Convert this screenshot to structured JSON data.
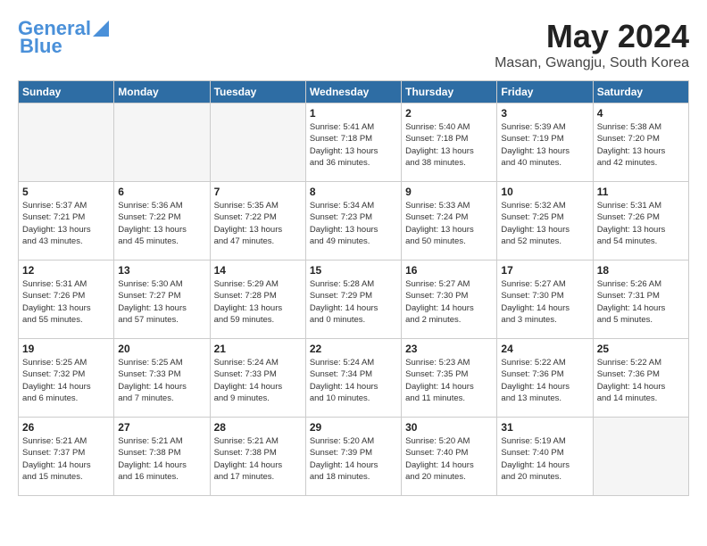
{
  "header": {
    "logo_line1": "General",
    "logo_line2": "Blue",
    "month": "May 2024",
    "location": "Masan, Gwangju, South Korea"
  },
  "days_of_week": [
    "Sunday",
    "Monday",
    "Tuesday",
    "Wednesday",
    "Thursday",
    "Friday",
    "Saturday"
  ],
  "weeks": [
    [
      {
        "day": "",
        "info": ""
      },
      {
        "day": "",
        "info": ""
      },
      {
        "day": "",
        "info": ""
      },
      {
        "day": "1",
        "info": "Sunrise: 5:41 AM\nSunset: 7:18 PM\nDaylight: 13 hours\nand 36 minutes."
      },
      {
        "day": "2",
        "info": "Sunrise: 5:40 AM\nSunset: 7:18 PM\nDaylight: 13 hours\nand 38 minutes."
      },
      {
        "day": "3",
        "info": "Sunrise: 5:39 AM\nSunset: 7:19 PM\nDaylight: 13 hours\nand 40 minutes."
      },
      {
        "day": "4",
        "info": "Sunrise: 5:38 AM\nSunset: 7:20 PM\nDaylight: 13 hours\nand 42 minutes."
      }
    ],
    [
      {
        "day": "5",
        "info": "Sunrise: 5:37 AM\nSunset: 7:21 PM\nDaylight: 13 hours\nand 43 minutes."
      },
      {
        "day": "6",
        "info": "Sunrise: 5:36 AM\nSunset: 7:22 PM\nDaylight: 13 hours\nand 45 minutes."
      },
      {
        "day": "7",
        "info": "Sunrise: 5:35 AM\nSunset: 7:22 PM\nDaylight: 13 hours\nand 47 minutes."
      },
      {
        "day": "8",
        "info": "Sunrise: 5:34 AM\nSunset: 7:23 PM\nDaylight: 13 hours\nand 49 minutes."
      },
      {
        "day": "9",
        "info": "Sunrise: 5:33 AM\nSunset: 7:24 PM\nDaylight: 13 hours\nand 50 minutes."
      },
      {
        "day": "10",
        "info": "Sunrise: 5:32 AM\nSunset: 7:25 PM\nDaylight: 13 hours\nand 52 minutes."
      },
      {
        "day": "11",
        "info": "Sunrise: 5:31 AM\nSunset: 7:26 PM\nDaylight: 13 hours\nand 54 minutes."
      }
    ],
    [
      {
        "day": "12",
        "info": "Sunrise: 5:31 AM\nSunset: 7:26 PM\nDaylight: 13 hours\nand 55 minutes."
      },
      {
        "day": "13",
        "info": "Sunrise: 5:30 AM\nSunset: 7:27 PM\nDaylight: 13 hours\nand 57 minutes."
      },
      {
        "day": "14",
        "info": "Sunrise: 5:29 AM\nSunset: 7:28 PM\nDaylight: 13 hours\nand 59 minutes."
      },
      {
        "day": "15",
        "info": "Sunrise: 5:28 AM\nSunset: 7:29 PM\nDaylight: 14 hours\nand 0 minutes."
      },
      {
        "day": "16",
        "info": "Sunrise: 5:27 AM\nSunset: 7:30 PM\nDaylight: 14 hours\nand 2 minutes."
      },
      {
        "day": "17",
        "info": "Sunrise: 5:27 AM\nSunset: 7:30 PM\nDaylight: 14 hours\nand 3 minutes."
      },
      {
        "day": "18",
        "info": "Sunrise: 5:26 AM\nSunset: 7:31 PM\nDaylight: 14 hours\nand 5 minutes."
      }
    ],
    [
      {
        "day": "19",
        "info": "Sunrise: 5:25 AM\nSunset: 7:32 PM\nDaylight: 14 hours\nand 6 minutes."
      },
      {
        "day": "20",
        "info": "Sunrise: 5:25 AM\nSunset: 7:33 PM\nDaylight: 14 hours\nand 7 minutes."
      },
      {
        "day": "21",
        "info": "Sunrise: 5:24 AM\nSunset: 7:33 PM\nDaylight: 14 hours\nand 9 minutes."
      },
      {
        "day": "22",
        "info": "Sunrise: 5:24 AM\nSunset: 7:34 PM\nDaylight: 14 hours\nand 10 minutes."
      },
      {
        "day": "23",
        "info": "Sunrise: 5:23 AM\nSunset: 7:35 PM\nDaylight: 14 hours\nand 11 minutes."
      },
      {
        "day": "24",
        "info": "Sunrise: 5:22 AM\nSunset: 7:36 PM\nDaylight: 14 hours\nand 13 minutes."
      },
      {
        "day": "25",
        "info": "Sunrise: 5:22 AM\nSunset: 7:36 PM\nDaylight: 14 hours\nand 14 minutes."
      }
    ],
    [
      {
        "day": "26",
        "info": "Sunrise: 5:21 AM\nSunset: 7:37 PM\nDaylight: 14 hours\nand 15 minutes."
      },
      {
        "day": "27",
        "info": "Sunrise: 5:21 AM\nSunset: 7:38 PM\nDaylight: 14 hours\nand 16 minutes."
      },
      {
        "day": "28",
        "info": "Sunrise: 5:21 AM\nSunset: 7:38 PM\nDaylight: 14 hours\nand 17 minutes."
      },
      {
        "day": "29",
        "info": "Sunrise: 5:20 AM\nSunset: 7:39 PM\nDaylight: 14 hours\nand 18 minutes."
      },
      {
        "day": "30",
        "info": "Sunrise: 5:20 AM\nSunset: 7:40 PM\nDaylight: 14 hours\nand 20 minutes."
      },
      {
        "day": "31",
        "info": "Sunrise: 5:19 AM\nSunset: 7:40 PM\nDaylight: 14 hours\nand 20 minutes."
      },
      {
        "day": "",
        "info": ""
      }
    ]
  ]
}
